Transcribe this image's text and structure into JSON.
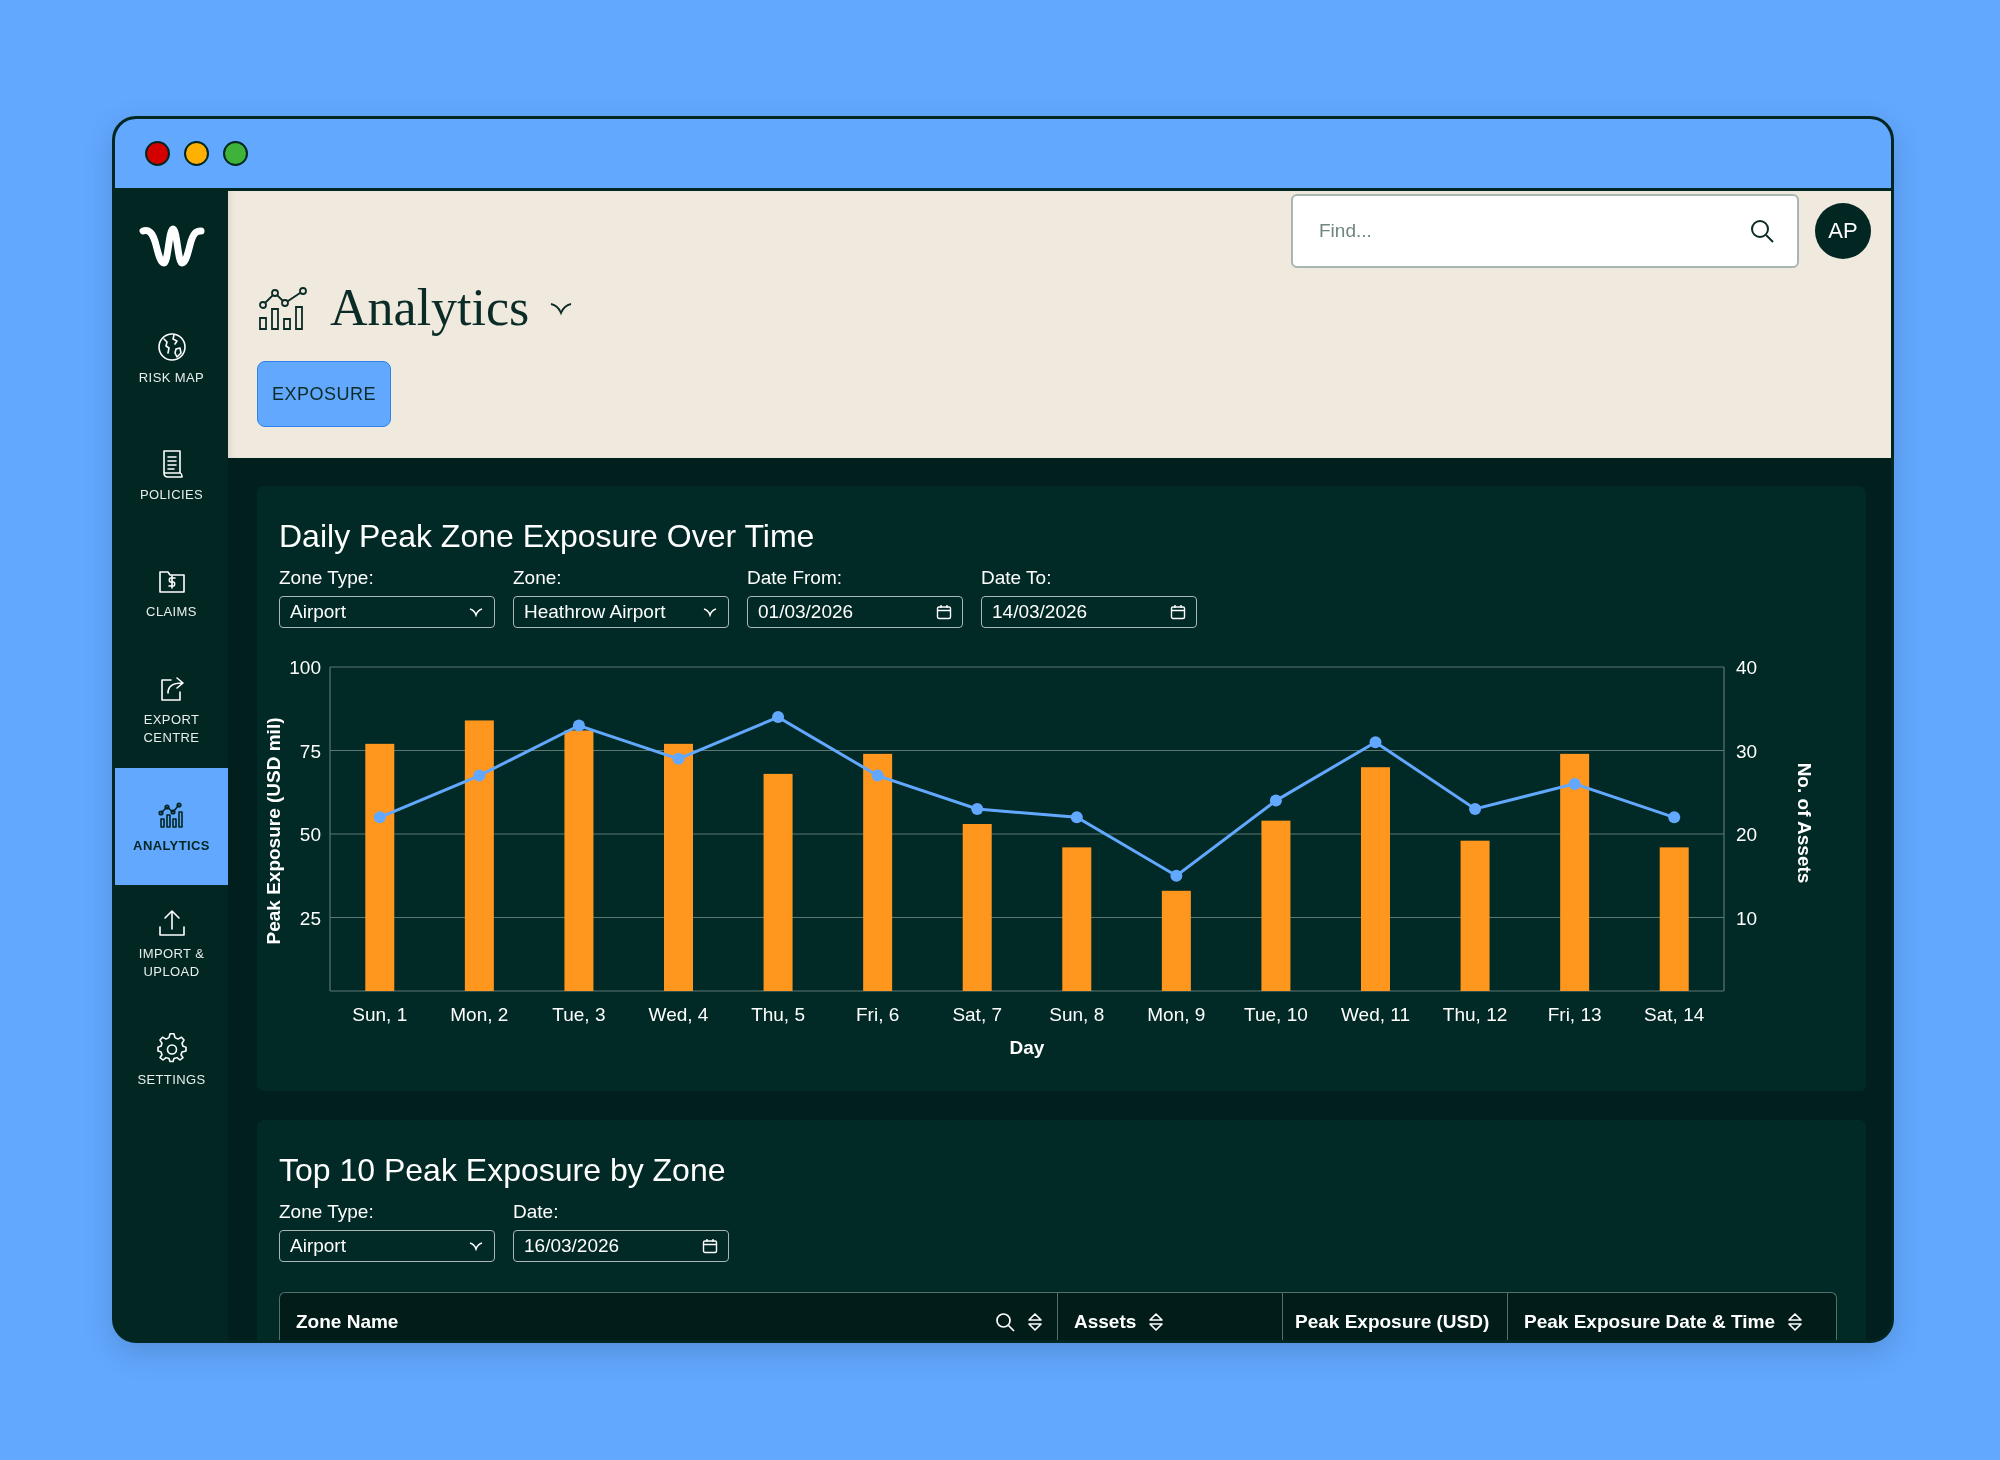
{
  "window": {
    "controls": [
      {
        "color": "#d40000"
      },
      {
        "color": "#ffb000"
      },
      {
        "color": "#3fb23a"
      }
    ]
  },
  "sidebar": {
    "items": [
      {
        "label": "RISK MAP",
        "selected": false
      },
      {
        "label": "POLICIES",
        "selected": false
      },
      {
        "label": "CLAIMS",
        "selected": false
      },
      {
        "label": "EXPORT CENTRE",
        "selected": false
      },
      {
        "label": "ANALYTICS",
        "selected": true
      },
      {
        "label": "IMPORT & UPLOAD",
        "selected": false
      },
      {
        "label": "SETTINGS",
        "selected": false
      }
    ]
  },
  "header": {
    "search": {
      "placeholder": "Find..."
    },
    "avatar": "AP",
    "title": "Analytics",
    "tabs": [
      {
        "label": "EXPOSURE",
        "selected": true
      }
    ]
  },
  "exposure_chart": {
    "title": "Daily Peak Zone Exposure Over Time",
    "filters": [
      {
        "label": "Zone Type:",
        "value": "Airport",
        "kind": "select"
      },
      {
        "label": "Zone:",
        "value": "Heathrow Airport",
        "kind": "select"
      },
      {
        "label": "Date From:",
        "value": "01/03/2026",
        "kind": "date"
      },
      {
        "label": "Date To:",
        "value": "14/03/2026",
        "kind": "date"
      }
    ],
    "chart_data": {
      "type": "bar",
      "xlabel": "Day",
      "ylabel": "Peak Exposure (USD mil)",
      "y2label": "No. of Assets",
      "categories": [
        "Sun, 1",
        "Mon, 2",
        "Tue, 3",
        "Wed, 4",
        "Thu, 5",
        "Fri, 6",
        "Sat, 7",
        "Sun, 8",
        "Mon, 9",
        "Tue, 10",
        "Wed, 11",
        "Thu, 12",
        "Fri, 13",
        "Sat, 14"
      ],
      "series": [
        {
          "color": "#ff961e",
          "values": [
            77,
            84,
            81,
            77,
            68,
            74,
            53,
            46,
            33,
            54,
            70,
            48,
            74,
            46
          ]
        },
        {
          "type": "line",
          "axis": "y2",
          "marker": true,
          "color": "#62a8ff",
          "values": [
            22,
            27,
            33,
            29,
            34,
            27,
            23,
            22,
            15,
            24,
            31,
            23,
            26,
            22
          ]
        }
      ],
      "grid": true,
      "ylim": [
        3,
        100
      ],
      "yticks": [
        25,
        50,
        75,
        100
      ],
      "y2lim": [
        1.2,
        40
      ],
      "y2ticks": [
        10,
        20,
        30,
        40
      ]
    }
  },
  "top_zones": {
    "title": "Top 10 Peak Exposure by Zone",
    "filters": [
      {
        "label": "Zone Type:",
        "value": "Airport",
        "kind": "select"
      },
      {
        "label": "Date:",
        "value": "16/03/2026",
        "kind": "date"
      }
    ],
    "table": {
      "columns": [
        {
          "label": "Zone Name",
          "search": true,
          "sortable": true
        },
        {
          "label": "Assets",
          "sortable": true
        },
        {
          "label": "Peak Exposure (USD)"
        },
        {
          "label": "Peak Exposure Date & Time",
          "sortable": true
        }
      ]
    }
  }
}
